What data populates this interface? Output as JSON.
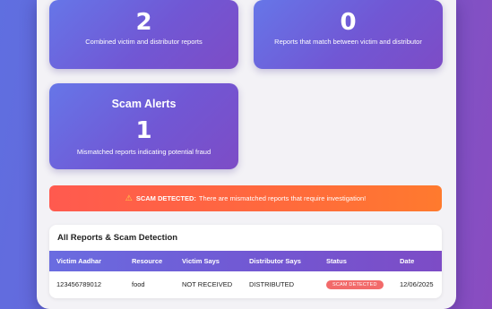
{
  "stats": {
    "total": {
      "value": "2",
      "label": "Combined victim and distributor reports"
    },
    "matched": {
      "value": "0",
      "label": "Reports that match between victim and distributor"
    },
    "scam": {
      "title": "Scam Alerts",
      "value": "1",
      "label": "Mismatched reports indicating potential fraud"
    }
  },
  "alert": {
    "icon": "warning-icon",
    "strong": "SCAM DETECTED:",
    "text": "There are mismatched reports that require investigation!"
  },
  "reports": {
    "title": "All Reports & Scam Detection",
    "columns": [
      "Victim Aadhar",
      "Resource",
      "Victim Says",
      "Distributor Says",
      "Status",
      "Date"
    ],
    "rows": [
      {
        "aadhar": "123456789012",
        "resource": "food",
        "victim_says": "NOT RECEIVED",
        "distributor_says": "DISTRIBUTED",
        "status": "SCAM DETECTED",
        "date": "12/06/2025"
      }
    ]
  },
  "colors": {
    "accent": "#6f5ad6",
    "alert": "#ff5e4a",
    "badge": "#f26a6a"
  }
}
